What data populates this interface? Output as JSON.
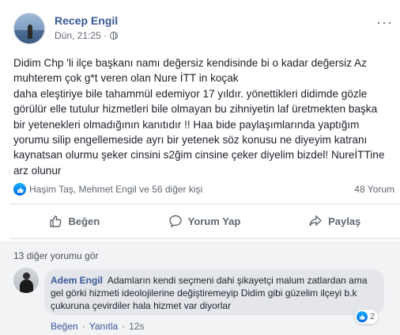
{
  "post": {
    "author": "Recep Engil",
    "time": "Dün, 21:25 ·",
    "more_icon": "ellipsis-icon",
    "privacy_icon": "globe-icon",
    "text_lines": [
      "Didim Chp 'li ilçe başkanı namı değersiz kendisinde bi o kadar değersiz Az",
      "muhterem çok g*t veren olan Nure İTT in koçak",
      "daha eleştiriye bile tahammül edemiyor 17 yıldır. yönettikleri didimde gözle",
      "görülür elle tutulur hizmetleri bile olmayan bu zihniyetin laf üretmekten başka",
      "bir yetenekleri olmadığının kanıtıdır !! Haa bide paylaşımlarında yaptığım",
      "yorumu silip engellemeside ayrı bir yetenek söz konusu ne diyeyim katranı",
      "kaynatsan olurmu şeker cinsini s2ğim cinsine çeker diyelim bizdel! NureİTTine",
      "arz olunur"
    ]
  },
  "reactions": {
    "summary": "Haşim Taş, Mehmet Engil ve 56 diğer kişi",
    "comment_count": "48 Yorum"
  },
  "actions": {
    "like": "Beğen",
    "comment": "Yorum Yap",
    "share": "Paylaş"
  },
  "comments": {
    "more_label": "13 diğer yorumu gör",
    "items": [
      {
        "author": "Adem Engil",
        "text": "Adamların kendi seçmeni dahi şikayetçi malum zatlardan ama gel görki hizmeti ideolojilerine değiştiremeyip Didim gibi güzelim ilçeyi b.k çukuruna çevirdiler hala hizmet var diyorlar",
        "reaction_count": "2",
        "like_label": "Beğen",
        "reply_label": "Yanıtla",
        "time": "12s"
      }
    ]
  },
  "colors": {
    "link": "#385898",
    "secondary": "#606770",
    "like_blue": "#1877f2"
  }
}
